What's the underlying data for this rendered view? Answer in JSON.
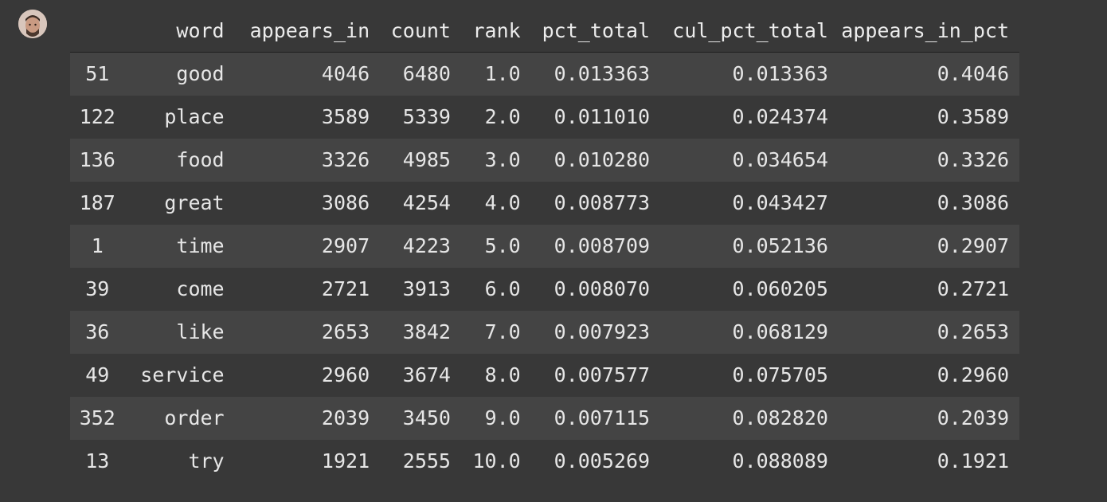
{
  "table": {
    "columns": [
      "",
      "word",
      "appears_in",
      "count",
      "rank",
      "pct_total",
      "cul_pct_total",
      "appears_in_pct"
    ],
    "rows": [
      {
        "index": "51",
        "word": "good",
        "appears_in": "4046",
        "count": "6480",
        "rank": "1.0",
        "pct_total": "0.013363",
        "cul_pct_total": "0.013363",
        "appears_in_pct": "0.4046"
      },
      {
        "index": "122",
        "word": "place",
        "appears_in": "3589",
        "count": "5339",
        "rank": "2.0",
        "pct_total": "0.011010",
        "cul_pct_total": "0.024374",
        "appears_in_pct": "0.3589"
      },
      {
        "index": "136",
        "word": "food",
        "appears_in": "3326",
        "count": "4985",
        "rank": "3.0",
        "pct_total": "0.010280",
        "cul_pct_total": "0.034654",
        "appears_in_pct": "0.3326"
      },
      {
        "index": "187",
        "word": "great",
        "appears_in": "3086",
        "count": "4254",
        "rank": "4.0",
        "pct_total": "0.008773",
        "cul_pct_total": "0.043427",
        "appears_in_pct": "0.3086"
      },
      {
        "index": "1",
        "word": "time",
        "appears_in": "2907",
        "count": "4223",
        "rank": "5.0",
        "pct_total": "0.008709",
        "cul_pct_total": "0.052136",
        "appears_in_pct": "0.2907"
      },
      {
        "index": "39",
        "word": "come",
        "appears_in": "2721",
        "count": "3913",
        "rank": "6.0",
        "pct_total": "0.008070",
        "cul_pct_total": "0.060205",
        "appears_in_pct": "0.2721"
      },
      {
        "index": "36",
        "word": "like",
        "appears_in": "2653",
        "count": "3842",
        "rank": "7.0",
        "pct_total": "0.007923",
        "cul_pct_total": "0.068129",
        "appears_in_pct": "0.2653"
      },
      {
        "index": "49",
        "word": "service",
        "appears_in": "2960",
        "count": "3674",
        "rank": "8.0",
        "pct_total": "0.007577",
        "cul_pct_total": "0.075705",
        "appears_in_pct": "0.2960"
      },
      {
        "index": "352",
        "word": "order",
        "appears_in": "2039",
        "count": "3450",
        "rank": "9.0",
        "pct_total": "0.007115",
        "cul_pct_total": "0.082820",
        "appears_in_pct": "0.2039"
      },
      {
        "index": "13",
        "word": "try",
        "appears_in": "1921",
        "count": "2555",
        "rank": "10.0",
        "pct_total": "0.005269",
        "cul_pct_total": "0.088089",
        "appears_in_pct": "0.1921"
      }
    ]
  },
  "icons": {
    "avatar": "user-avatar-icon"
  },
  "colors": {
    "background": "#383838",
    "row_stripe": "#444444",
    "text": "#e6e6e6"
  }
}
